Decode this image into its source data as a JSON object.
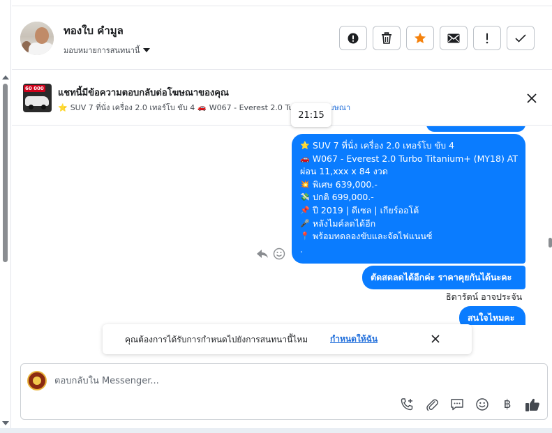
{
  "header": {
    "contact_name": "ทองใบ คำมูล",
    "assign_label": "มอบหมายการสนทนานี้",
    "actions": [
      {
        "name": "spam-button",
        "icon": "alert-circle-icon"
      },
      {
        "name": "delete-button",
        "icon": "trash-icon"
      },
      {
        "name": "star-button",
        "icon": "star-icon"
      },
      {
        "name": "mark-unread-button",
        "icon": "envelope-icon"
      },
      {
        "name": "follow-up-button",
        "icon": "exclamation-icon"
      },
      {
        "name": "mark-done-button",
        "icon": "check-icon"
      }
    ]
  },
  "ad_banner": {
    "title": "แชทนี้มีข้อความตอบกลับต่อโฆษณาของคุณ",
    "thumb_price": "60 000",
    "sub_star": "⭐",
    "sub_text_1": "SUV 7 ที่นั่ง เครื่อง 2.0 เทอร์โบ ขับ 4",
    "sub_text_2": "W067 - Everest 2.0 Tu",
    "sub_link": "โฆษณา"
  },
  "timestamp_tooltip": "21:15",
  "thread": {
    "main_message": [
      {
        "icon": "⭐",
        "text": "SUV 7 ที่นั่ง เครื่อง 2.0 เทอร์โบ ขับ 4"
      },
      {
        "icon": "🚗",
        "text": "W067 - Everest 2.0 Turbo Titanium+ (MY18) AT"
      },
      {
        "icon": "",
        "text": "ผ่อน 11,xxx x 84 งวด"
      },
      {
        "icon": "💥",
        "text": "พิเศษ 639,000.-"
      },
      {
        "icon": "💸",
        "text": "ปกติ 699,000.-"
      },
      {
        "icon": "📌",
        "text": "ปี 2019 | ดีเซล | เกียร์ออโต้"
      },
      {
        "icon": "🎤",
        "text": "หลังไมค์ลดได้อีก"
      },
      {
        "icon": "📍",
        "text": "พร้อมทดลองขับและจัดไฟแนนซ์"
      },
      {
        "icon": "",
        "text": "."
      }
    ],
    "message_ask": "ตัดสดลดได้อีกค่ะ ราคาคุยกันได้นะคะ",
    "sender_name": "ธิดารัตน์ อาจประจัน",
    "message_interest": "สนใจไหมคะ"
  },
  "toast": {
    "message": "คุณต้องการได้รับการกำหนดไปยังการสนทนานี้ไหม",
    "link": "กำหนดให้ฉัน"
  },
  "composer": {
    "placeholder": "ตอบกลับใน Messenger...",
    "tools": [
      "call-add-icon",
      "paperclip-icon",
      "chat-bubble-icon",
      "smiley-icon",
      "baht-icon",
      "thumbs-up-icon"
    ],
    "baht_symbol": "฿"
  },
  "colors": {
    "bubble": "#0a7cff",
    "link": "#216fdb",
    "star": "#f5820d"
  }
}
